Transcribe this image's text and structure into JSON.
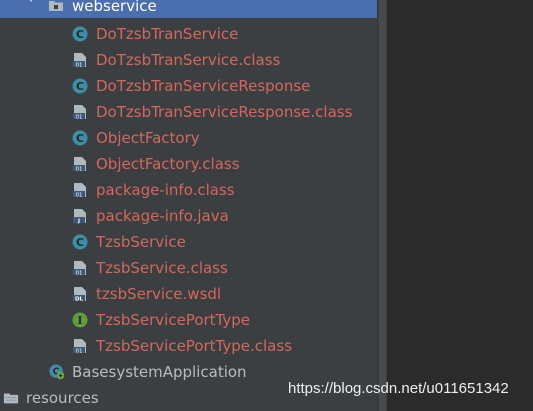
{
  "tree": {
    "folder": {
      "label": "webservice",
      "icon": "package-folder-icon",
      "expanded": true
    },
    "items": [
      {
        "label": "DoTzsbTranService",
        "icon": "java-class-icon"
      },
      {
        "label": "DoTzsbTranService.class",
        "icon": "compiled-class-file-icon"
      },
      {
        "label": "DoTzsbTranServiceResponse",
        "icon": "java-class-icon"
      },
      {
        "label": "DoTzsbTranServiceResponse.class",
        "icon": "compiled-class-file-icon"
      },
      {
        "label": "ObjectFactory",
        "icon": "java-class-icon"
      },
      {
        "label": "ObjectFactory.class",
        "icon": "compiled-class-file-icon"
      },
      {
        "label": "package-info.class",
        "icon": "compiled-class-file-icon"
      },
      {
        "label": "package-info.java",
        "icon": "java-source-file-icon"
      },
      {
        "label": "TzsbService",
        "icon": "java-class-icon"
      },
      {
        "label": "TzsbService.class",
        "icon": "compiled-class-file-icon"
      },
      {
        "label": "tzsbService.wsdl",
        "icon": "wsdl-file-icon"
      },
      {
        "label": "TzsbServicePortType",
        "icon": "java-interface-icon"
      },
      {
        "label": "TzsbServicePortType.class",
        "icon": "compiled-class-file-icon"
      }
    ],
    "app_class": {
      "label": "BasesystemApplication",
      "icon": "spring-boot-application-icon"
    },
    "resources": {
      "label": "resources",
      "icon": "resources-folder-icon"
    }
  },
  "watermark": "https://blog.csdn.net/u011651342",
  "colors": {
    "panel_bg": "#3c3f41",
    "editor_bg": "#2b2b2b",
    "selection": "#4b6eaf",
    "unversioned_red": "#d3675c",
    "class_icon": "#3d8ea8",
    "interface_icon": "#5f9e3f"
  }
}
